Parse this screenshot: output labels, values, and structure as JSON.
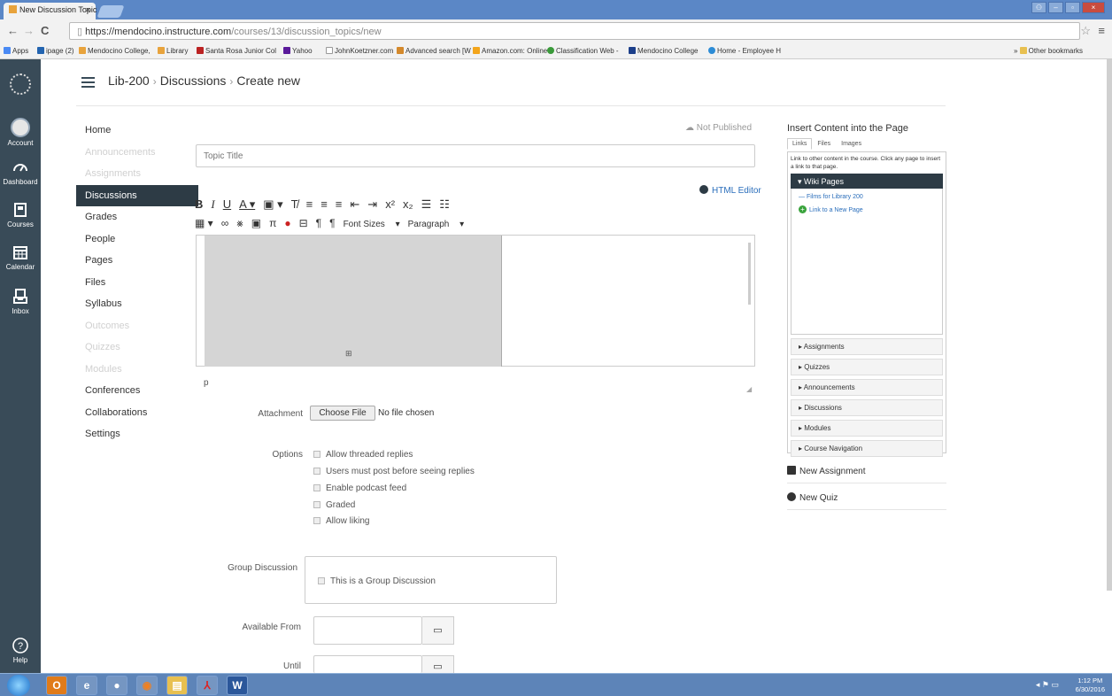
{
  "browser": {
    "tab_title": "New Discussion Topic",
    "url_host": "https://mendocino.instructure.com",
    "url_path": "/courses/13/discussion_topics/new",
    "bookmarks": [
      "Apps",
      "ipage (2)",
      "Mendocino College, ",
      "Library",
      "Santa Rosa Junior Col",
      "Yahoo",
      "JohnKoetzner.com",
      "Advanced search [W",
      "Amazon.com: Online",
      "Classification Web - ",
      "Mendocino College ",
      "Home - Employee H"
    ],
    "other_bookmarks": "Other bookmarks"
  },
  "global_nav": {
    "items": [
      {
        "label": "Account",
        "icon": "account-icon"
      },
      {
        "label": "Dashboard",
        "icon": "dashboard-icon"
      },
      {
        "label": "Courses",
        "icon": "courses-icon"
      },
      {
        "label": "Calendar",
        "icon": "calendar-icon"
      },
      {
        "label": "Inbox",
        "icon": "inbox-icon"
      }
    ],
    "help": "Help"
  },
  "breadcrumb": {
    "course": "Lib-200",
    "section": "Discussions",
    "page": "Create new"
  },
  "course_nav": [
    {
      "label": "Home",
      "state": "normal"
    },
    {
      "label": "Announcements",
      "state": "disabled"
    },
    {
      "label": "Assignments",
      "state": "disabled"
    },
    {
      "label": "Discussions",
      "state": "active"
    },
    {
      "label": "Grades",
      "state": "normal"
    },
    {
      "label": "People",
      "state": "normal"
    },
    {
      "label": "Pages",
      "state": "normal"
    },
    {
      "label": "Files",
      "state": "normal"
    },
    {
      "label": "Syllabus",
      "state": "normal"
    },
    {
      "label": "Outcomes",
      "state": "disabled"
    },
    {
      "label": "Quizzes",
      "state": "disabled"
    },
    {
      "label": "Modules",
      "state": "disabled"
    },
    {
      "label": "Conferences",
      "state": "normal"
    },
    {
      "label": "Collaborations",
      "state": "normal"
    },
    {
      "label": "Settings",
      "state": "normal"
    }
  ],
  "form": {
    "status": "Not Published",
    "title_placeholder": "Topic Title",
    "html_editor": "HTML Editor",
    "font_sizes": "Font Sizes",
    "paragraph": "Paragraph",
    "path": "p",
    "attachment_label": "Attachment",
    "choose_file": "Choose File",
    "no_file": "No file chosen",
    "options_label": "Options",
    "options": [
      "Allow threaded replies",
      "Users must post before seeing replies",
      "Enable podcast feed",
      "Graded",
      "Allow liking"
    ],
    "group_label": "Group Discussion",
    "group_option": "This is a Group Discussion",
    "available_from": "Available From",
    "until": "Until"
  },
  "sidebar": {
    "heading": "Insert Content into the Page",
    "tabs": [
      "Links",
      "Files",
      "Images"
    ],
    "desc": "Link to other content in the course. Click any page to insert a link to that page.",
    "wiki_header": "Wiki Pages",
    "wiki_items": [
      "Films for Library 200"
    ],
    "new_page": "Link to a New Page",
    "sections": [
      "Assignments",
      "Quizzes",
      "Announcements",
      "Discussions",
      "Modules",
      "Course Navigation"
    ],
    "new_assignment": "New Assignment",
    "new_quiz": "New Quiz"
  },
  "taskbar": {
    "time": "1:12 PM",
    "date": "6/30/2016"
  }
}
